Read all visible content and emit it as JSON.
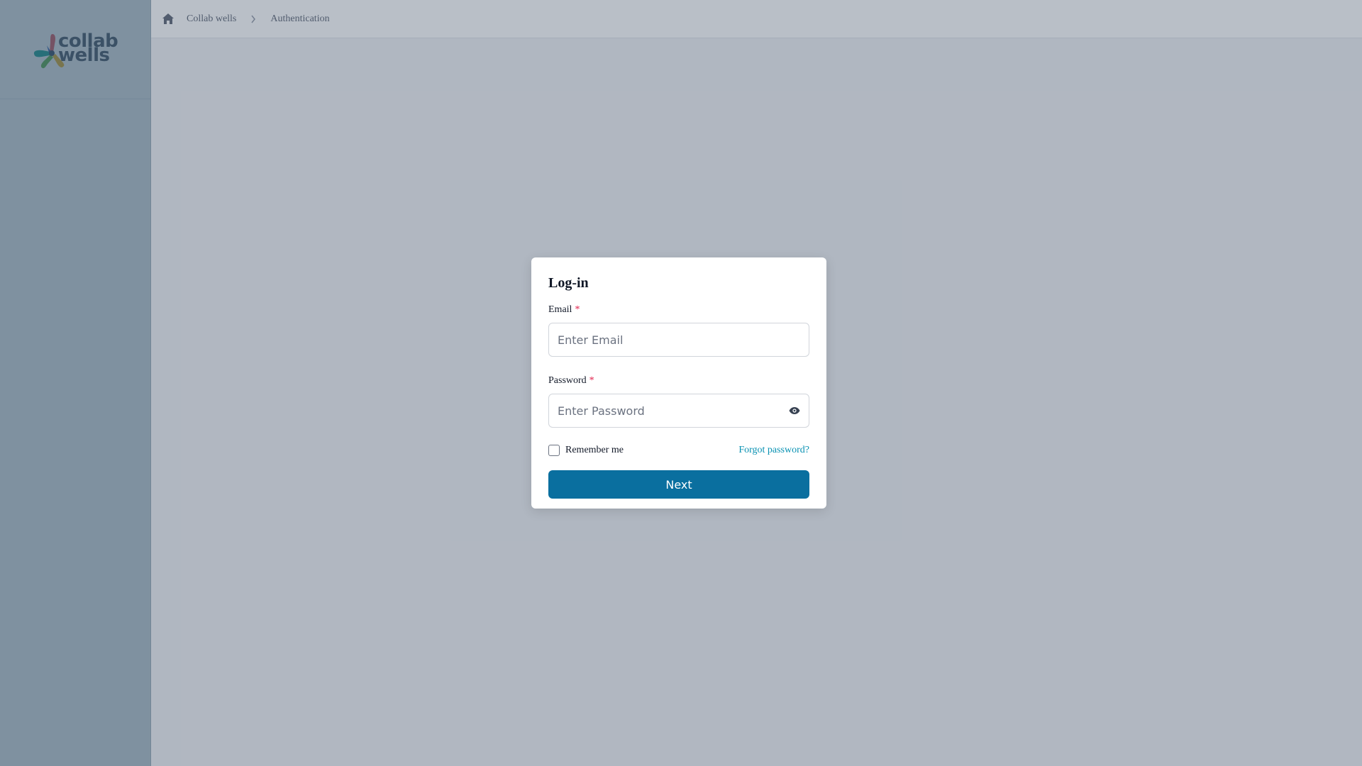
{
  "app": {
    "logo_line1": "collab",
    "logo_line2": "wells"
  },
  "breadcrumb": {
    "home_icon": "home-icon",
    "items": [
      {
        "label": "Collab wells"
      },
      {
        "label": "Authentication"
      }
    ],
    "separator_icon": "chevron-right-icon"
  },
  "login": {
    "title": "Log-in",
    "email_label": "Email",
    "email_required": "*",
    "email_placeholder": "Enter Email",
    "email_value": "",
    "password_label": "Password",
    "password_required": "*",
    "password_placeholder": "Enter Password",
    "password_value": "",
    "password_toggle_icon": "eye-icon",
    "remember_label": "Remember me",
    "remember_checked": false,
    "forgot_label": "Forgot password?",
    "submit_label": "Next"
  },
  "colors": {
    "primary": "#0a6f9f",
    "link": "#0891b2",
    "required": "#e11d48",
    "overlay": "rgba(23, 42, 70, 0.30)"
  }
}
